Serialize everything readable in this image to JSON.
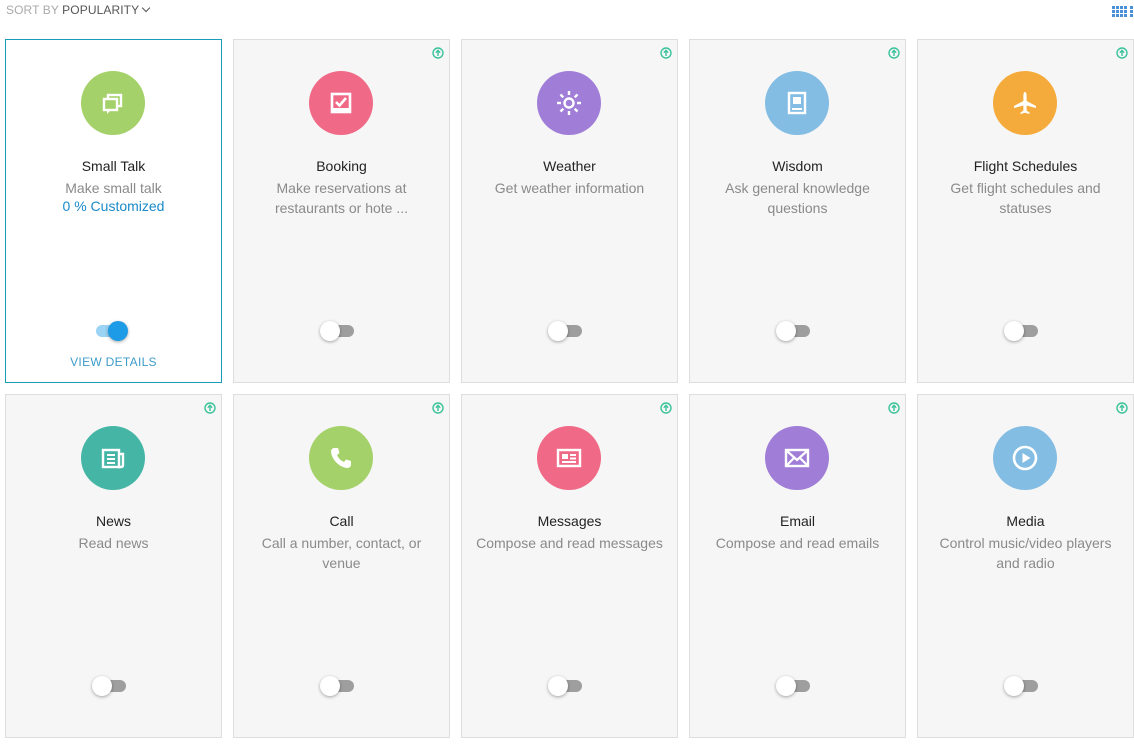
{
  "topbar": {
    "sort_by": "SORT BY",
    "sort_value": "POPULARITY"
  },
  "colors": {
    "accent": "#1a9bb8",
    "green": "#a5d16a",
    "pink": "#f06a87",
    "purple": "#a07ed8",
    "blue": "#84bde3",
    "orange": "#f4ab3c",
    "teal": "#45b6a6",
    "upgrade": "#3bc39a"
  },
  "cards": [
    {
      "title": "Small Talk",
      "desc": "Make small talk",
      "customized": "0 % Customized",
      "view_details": "VIEW DETAILS",
      "icon": "chat-bubbles-icon",
      "enabled": true
    },
    {
      "title": "Booking",
      "desc": "Make reservations at restaurants or hote ...",
      "icon": "calendar-check-icon",
      "enabled": false
    },
    {
      "title": "Weather",
      "desc": "Get weather information",
      "icon": "sun-icon",
      "enabled": false
    },
    {
      "title": "Wisdom",
      "desc": "Ask general knowledge questions",
      "icon": "book-icon",
      "enabled": false
    },
    {
      "title": "Flight Schedules",
      "desc": "Get flight schedules and statuses",
      "icon": "airplane-icon",
      "enabled": false
    },
    {
      "title": "News",
      "desc": "Read news",
      "icon": "newspaper-icon",
      "enabled": false
    },
    {
      "title": "Call",
      "desc": "Call a number, contact, or venue",
      "icon": "phone-icon",
      "enabled": false
    },
    {
      "title": "Messages",
      "desc": "Compose and read messages",
      "icon": "message-icon",
      "enabled": false
    },
    {
      "title": "Email",
      "desc": "Compose and read emails",
      "icon": "envelope-icon",
      "enabled": false
    },
    {
      "title": "Media",
      "desc": "Control music/video players and radio",
      "icon": "play-icon",
      "enabled": false
    }
  ]
}
